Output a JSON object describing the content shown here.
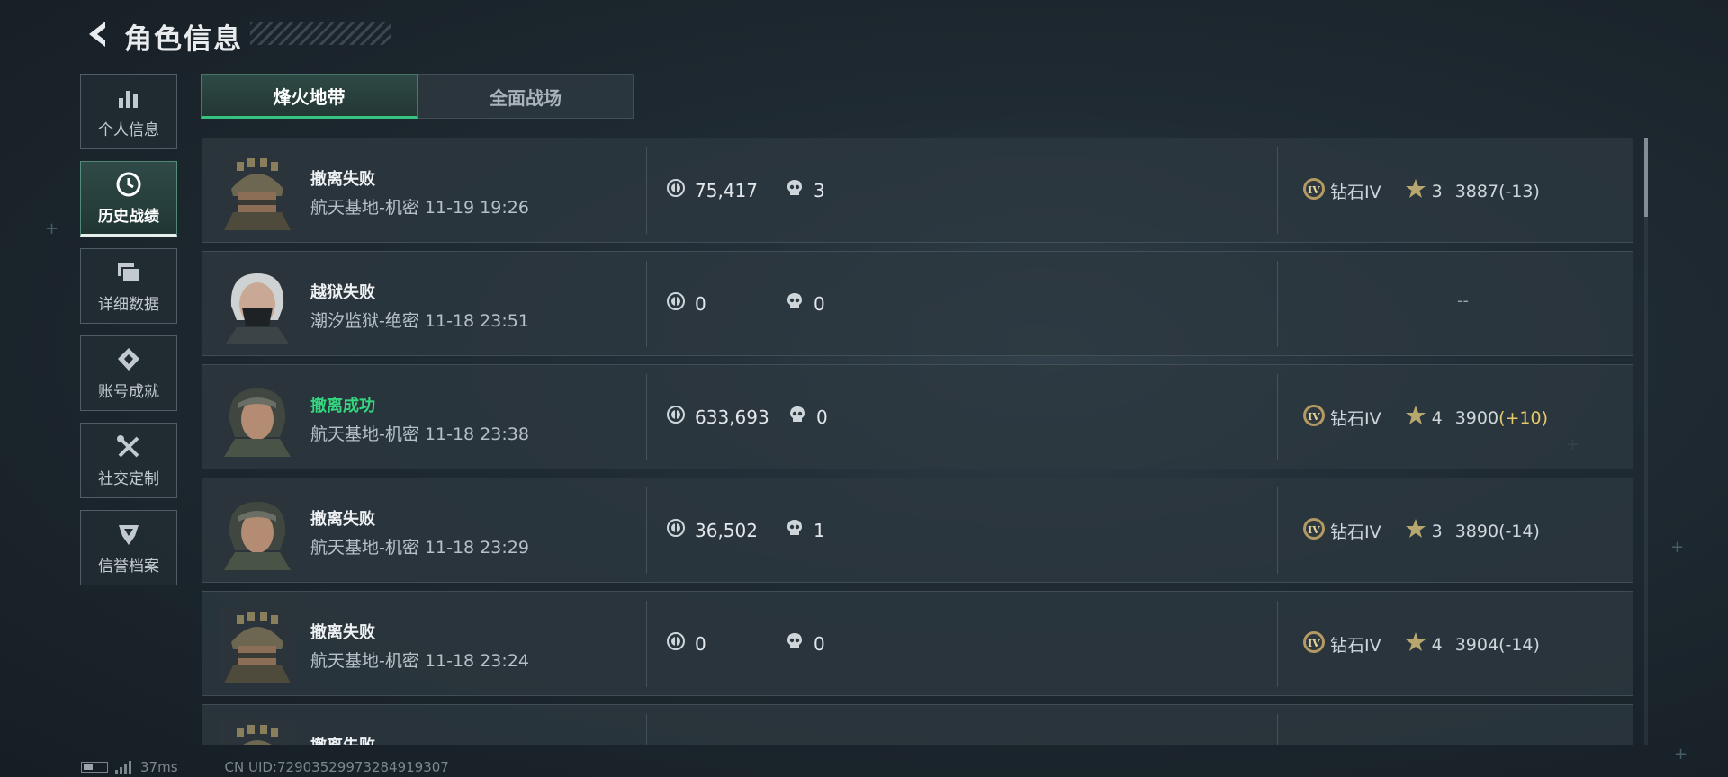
{
  "header": {
    "title": "角色信息",
    "back_icon": "chevron-left-icon"
  },
  "sidebar": {
    "items": [
      {
        "label": "个人信息",
        "icon": "bar-chart-icon",
        "active": false
      },
      {
        "label": "历史战绩",
        "icon": "history-clock-icon",
        "active": true
      },
      {
        "label": "详细数据",
        "icon": "folder-icon",
        "active": false
      },
      {
        "label": "账号成就",
        "icon": "achievement-icon",
        "active": false
      },
      {
        "label": "社交定制",
        "icon": "tools-icon",
        "active": false
      },
      {
        "label": "信誉档案",
        "icon": "credit-shield-icon",
        "active": false
      }
    ]
  },
  "tabs": [
    {
      "label": "烽火地带",
      "active": true
    },
    {
      "label": "全面战场",
      "active": false
    }
  ],
  "matches": [
    {
      "result": "撤离失败",
      "success": false,
      "map": "航天基地-机密",
      "time": "11-19 19:26",
      "money": "75,417",
      "kills": "3",
      "avatar": "helmet",
      "rank": "钻石IV",
      "stars": "3",
      "score": "3887",
      "delta": "(-13)"
    },
    {
      "result": "越狱失败",
      "success": false,
      "map": "潮汐监狱-绝密",
      "time": "11-18 23:51",
      "money": "0",
      "kills": "0",
      "avatar": "masked",
      "rank": null,
      "rank_empty": "--"
    },
    {
      "result": "撤离成功",
      "success": true,
      "map": "航天基地-机密",
      "time": "11-18 23:38",
      "money": "633,693",
      "kills": "0",
      "avatar": "scarf",
      "rank": "钻石IV",
      "stars": "4",
      "score": "3900",
      "delta": "(+10)"
    },
    {
      "result": "撤离失败",
      "success": false,
      "map": "航天基地-机密",
      "time": "11-18 23:29",
      "money": "36,502",
      "kills": "1",
      "avatar": "scarf",
      "rank": "钻石IV",
      "stars": "3",
      "score": "3890",
      "delta": "(-14)"
    },
    {
      "result": "撤离失败",
      "success": false,
      "map": "航天基地-机密",
      "time": "11-18 23:24",
      "money": "0",
      "kills": "0",
      "avatar": "helmet",
      "rank": "钻石IV",
      "stars": "4",
      "score": "3904",
      "delta": "(-14)"
    },
    {
      "result": "撤离失败",
      "success": false,
      "map": "",
      "time": "",
      "money": "",
      "kills": "",
      "avatar": "helmet",
      "rank": null,
      "rank_empty": ""
    }
  ],
  "footer": {
    "ping": "37ms",
    "uid": "CN UID:72903529973284919307"
  },
  "colors": {
    "success": "#35d67f",
    "accent_tab": "#36c27f",
    "delta_positive": "#e7c86b"
  }
}
